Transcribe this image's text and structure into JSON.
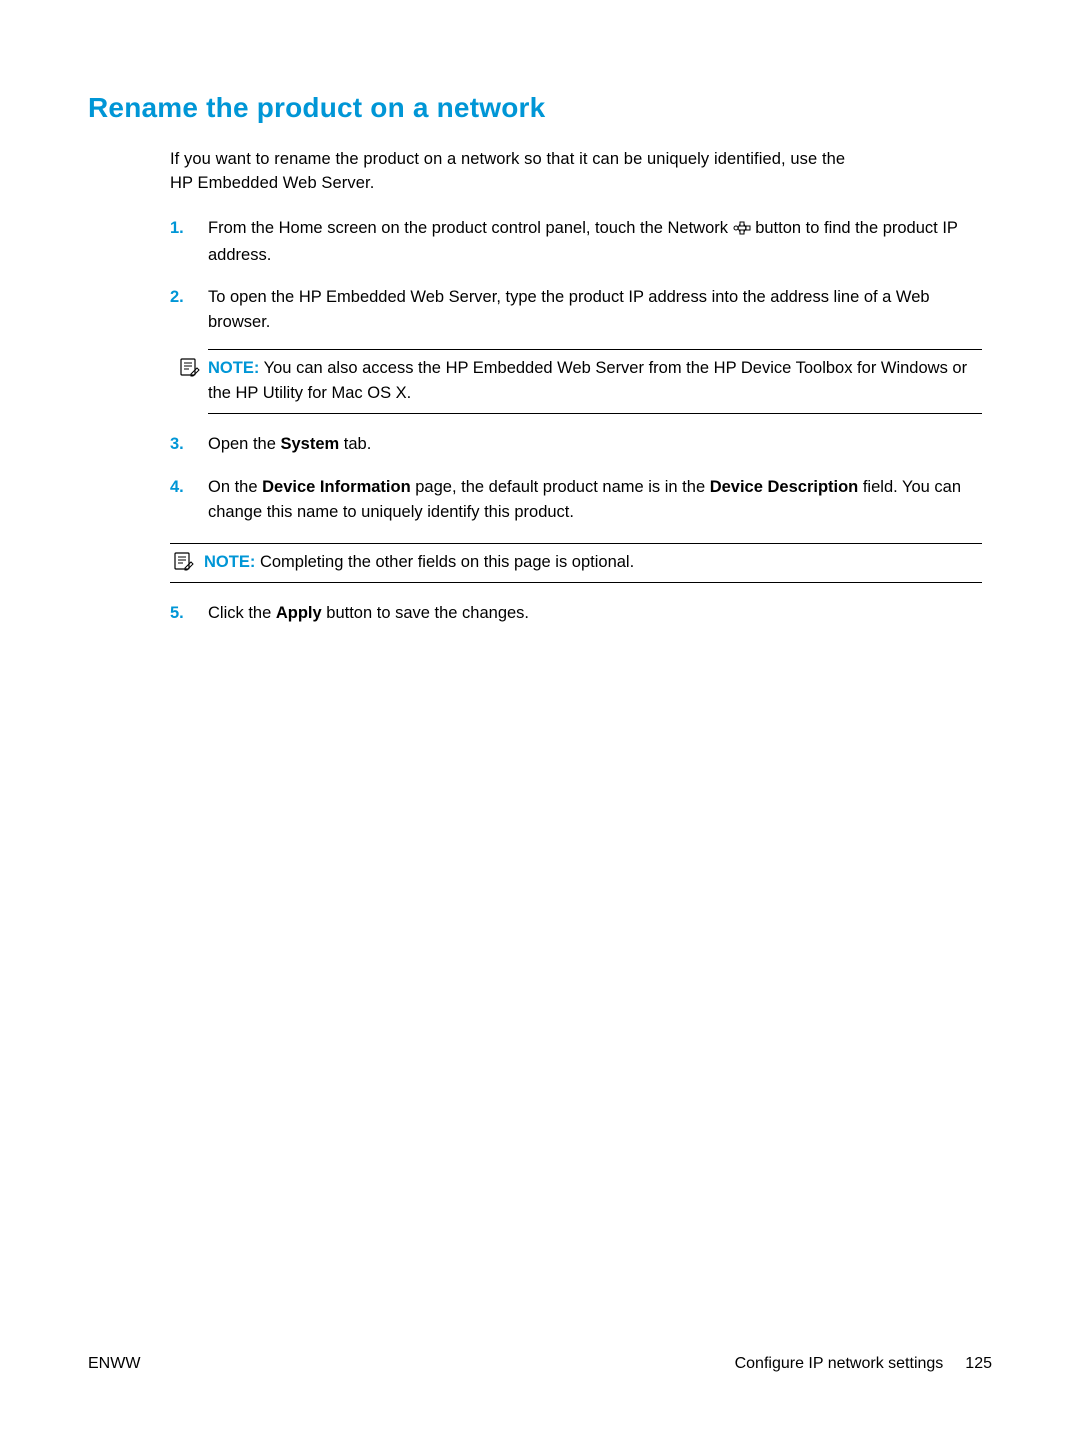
{
  "heading": "Rename the product on a network",
  "intro_line1": "If you want to rename the product on a network so that it can be uniquely identified, use the",
  "intro_line2": "HP Embedded Web Server.",
  "steps": {
    "s1": {
      "num": "1.",
      "text_a": "From the Home screen on the product control panel, touch the Network ",
      "text_b": " button to find the product IP address."
    },
    "s2": {
      "num": "2.",
      "text": "To open the HP Embedded Web Server, type the product IP address into the address line of a Web browser."
    },
    "note1": {
      "label": "NOTE:",
      "text": "You can also access the HP Embedded Web Server from the HP Device Toolbox for Windows or the HP Utility for Mac OS X."
    },
    "s3": {
      "num": "3.",
      "text_a": "Open the ",
      "bold_a": "System",
      "text_b": " tab."
    },
    "s4": {
      "num": "4.",
      "text_a": "On the ",
      "bold_a": "Device Information",
      "text_b": " page, the default product name is in the ",
      "bold_b": "Device Description",
      "text_c": " field. You can change this name to uniquely identify this product."
    },
    "note2": {
      "label": "NOTE:",
      "text": "Completing the other fields on this page is optional."
    },
    "s5": {
      "num": "5.",
      "text_a": "Click the ",
      "bold_a": "Apply",
      "text_b": " button to save the changes."
    }
  },
  "footer": {
    "left": "ENWW",
    "right_text": "Configure IP network settings",
    "page": "125"
  }
}
